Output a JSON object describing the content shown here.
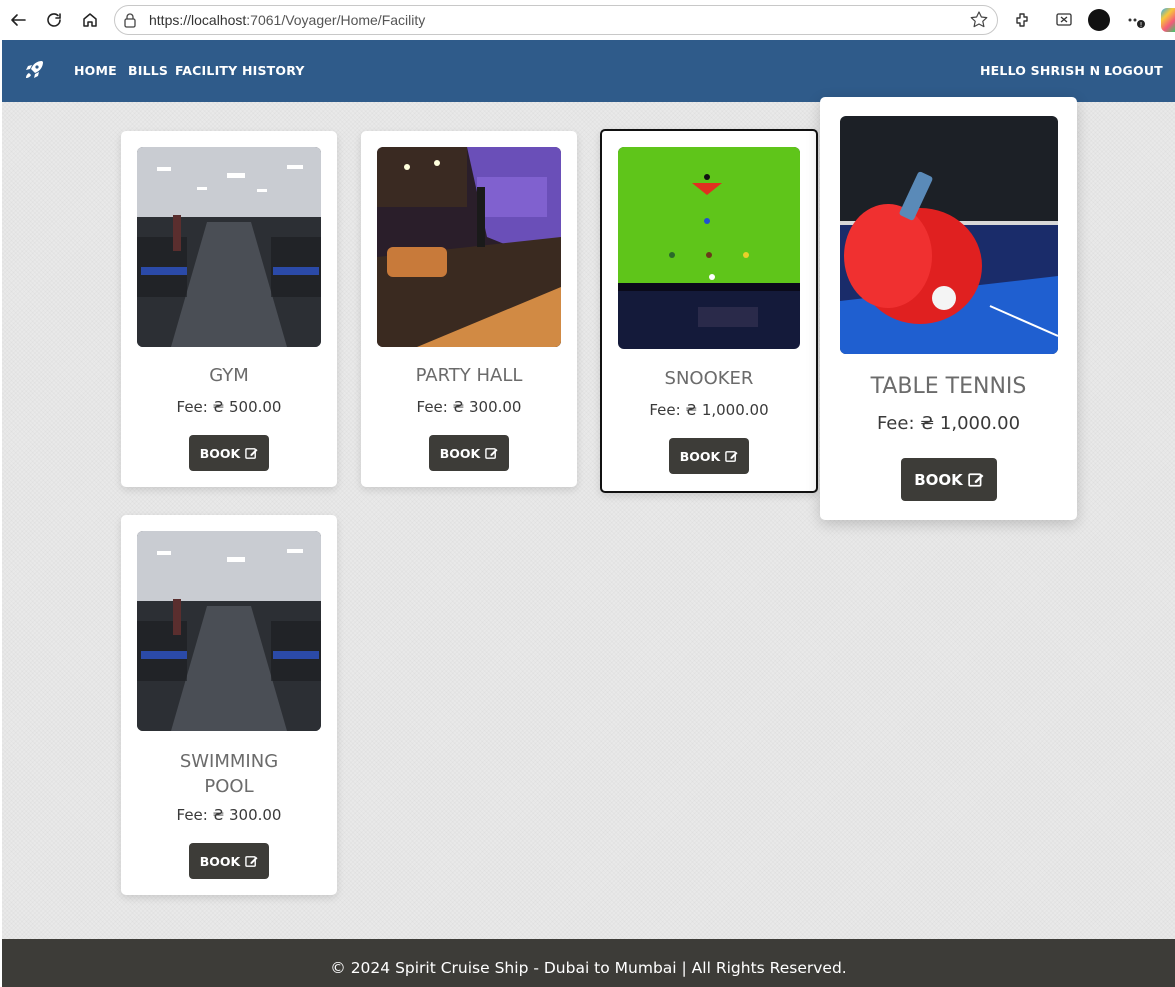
{
  "browser": {
    "url_host": "https://localhost",
    "url_rest": ":7061/Voyager/Home/Facility"
  },
  "nav": {
    "home": "HOME",
    "bills": "BILLS",
    "history": "FACILITY HISTORY",
    "greeting": "HELLO SHRISH N !",
    "logout": "LOGOUT"
  },
  "facilities": [
    {
      "name": "GYM",
      "fee": "Fee: ₴ 500.00",
      "book": "BOOK"
    },
    {
      "name": "PARTY HALL",
      "fee": "Fee: ₴ 300.00",
      "book": "BOOK"
    },
    {
      "name": "SNOOKER",
      "fee": "Fee: ₴ 1,000.00",
      "book": "BOOK"
    },
    {
      "name": "TABLE TENNIS",
      "fee": "Fee: ₴ 1,000.00",
      "book": "BOOK"
    },
    {
      "name_line1": "SWIMMING",
      "name_line2": "POOL",
      "fee": "Fee: ₴ 300.00",
      "book": "BOOK"
    }
  ],
  "footer": {
    "text": "© 2024 Spirit Cruise Ship - Dubai to Mumbai | All Rights Reserved."
  },
  "colors": {
    "navbar": "#2f5b8a",
    "button": "#3d3c38",
    "footer": "#3d3c38"
  }
}
